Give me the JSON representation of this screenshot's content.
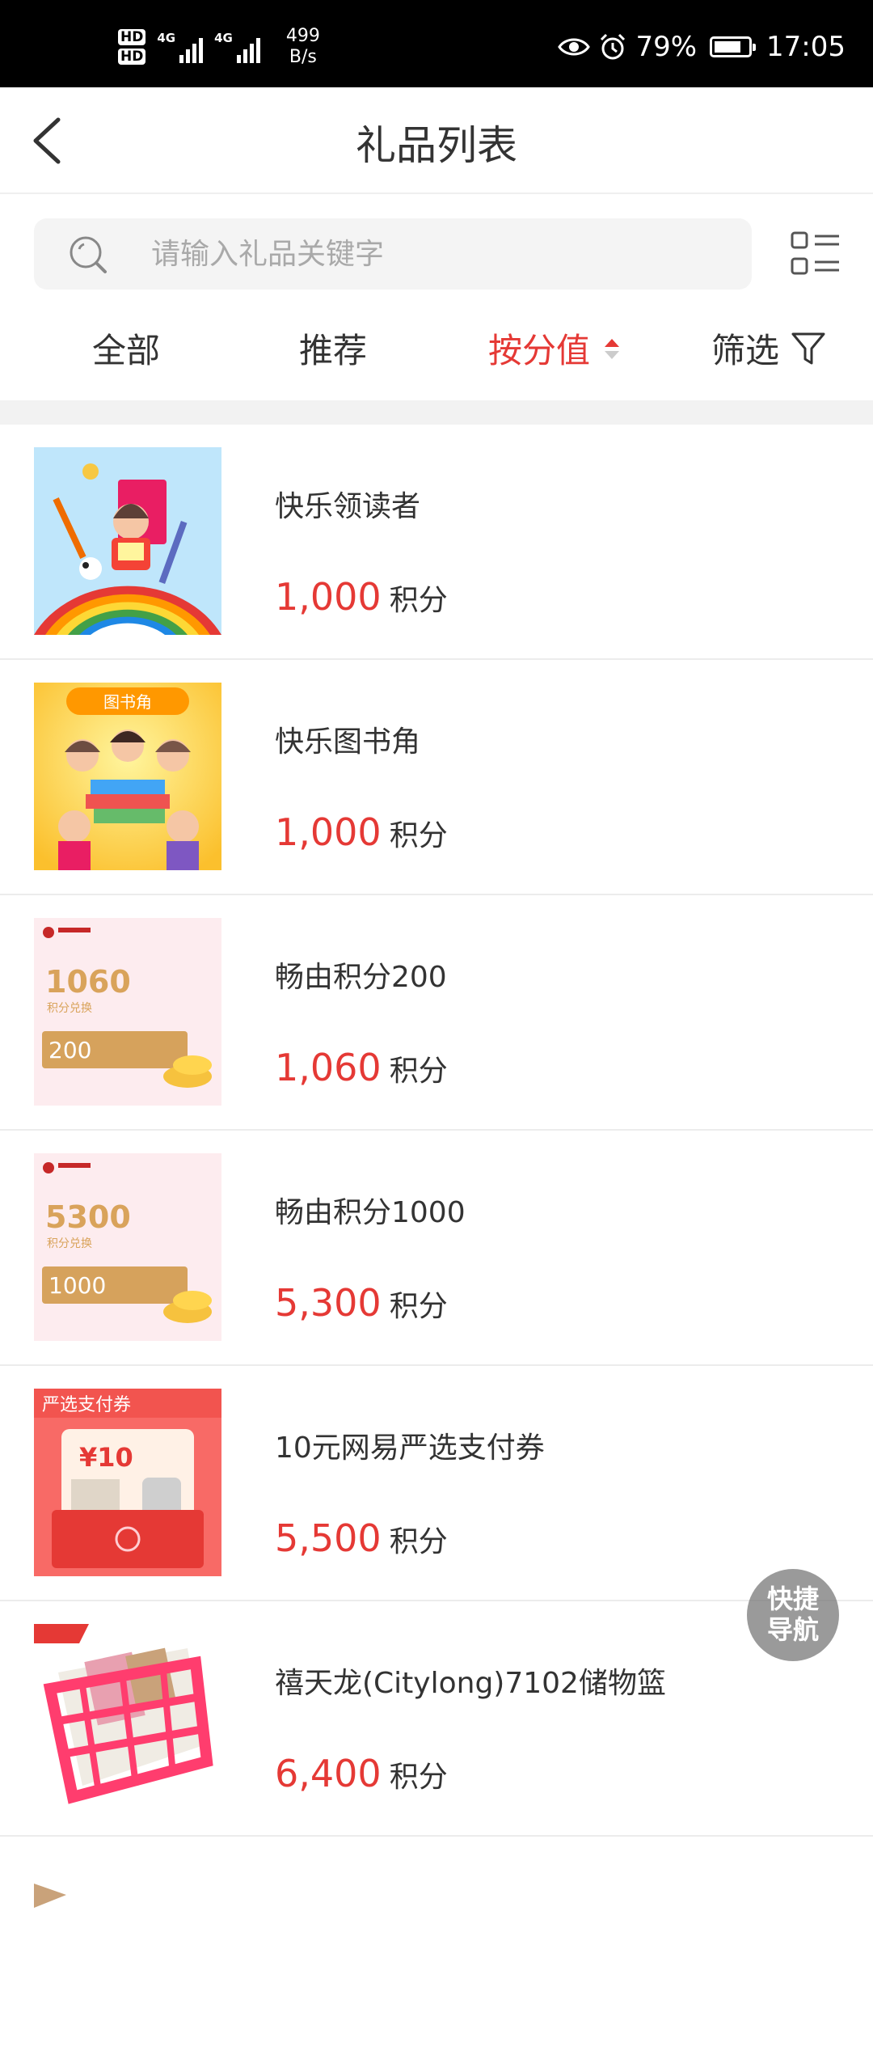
{
  "status_bar": {
    "hd1": "HD",
    "hd2": "HD",
    "sim1": "4G",
    "sim2": "4G",
    "speed_value": "499",
    "speed_unit": "B/s",
    "battery_percent": "79%",
    "battery_level": 0.79,
    "time": "17:05"
  },
  "header": {
    "title": "礼品列表"
  },
  "search": {
    "placeholder": "请输入礼品关键字",
    "value": ""
  },
  "tabs": [
    {
      "label": "全部",
      "active": false
    },
    {
      "label": "推荐",
      "active": false
    },
    {
      "label": "按分值",
      "active": true
    },
    {
      "label": "筛选",
      "active": false
    }
  ],
  "colors": {
    "accent": "#e53935",
    "text": "#333333",
    "placeholder": "#a9a9a9"
  },
  "gifts": [
    {
      "name": "快乐领读者",
      "points": "1,000",
      "unit": "积分",
      "image": "happy-reader-illustration"
    },
    {
      "name": "快乐图书角",
      "points": "1,000",
      "unit": "积分",
      "image": "book-corner-illustration",
      "image_text": "图书角"
    },
    {
      "name": "畅由积分200",
      "points": "1,060",
      "unit": "积分",
      "image": "points-card",
      "card_big": "1060",
      "card_small": "积分兑换",
      "card_bar": "200"
    },
    {
      "name": "畅由积分1000",
      "points": "5,300",
      "unit": "积分",
      "image": "points-card",
      "card_big": "5300",
      "card_small": "积分兑换",
      "card_bar": "1000"
    },
    {
      "name": "10元网易严选支付券",
      "points": "5,500",
      "unit": "积分",
      "image": "coupon-envelope",
      "image_text": "严选支付券",
      "coupon_value": "¥10"
    },
    {
      "name": "禧天龙(Citylong)7102储物篮",
      "points": "6,400",
      "unit": "积分",
      "image": "storage-basket"
    }
  ],
  "quick_nav": {
    "line1": "快捷",
    "line2": "导航"
  }
}
